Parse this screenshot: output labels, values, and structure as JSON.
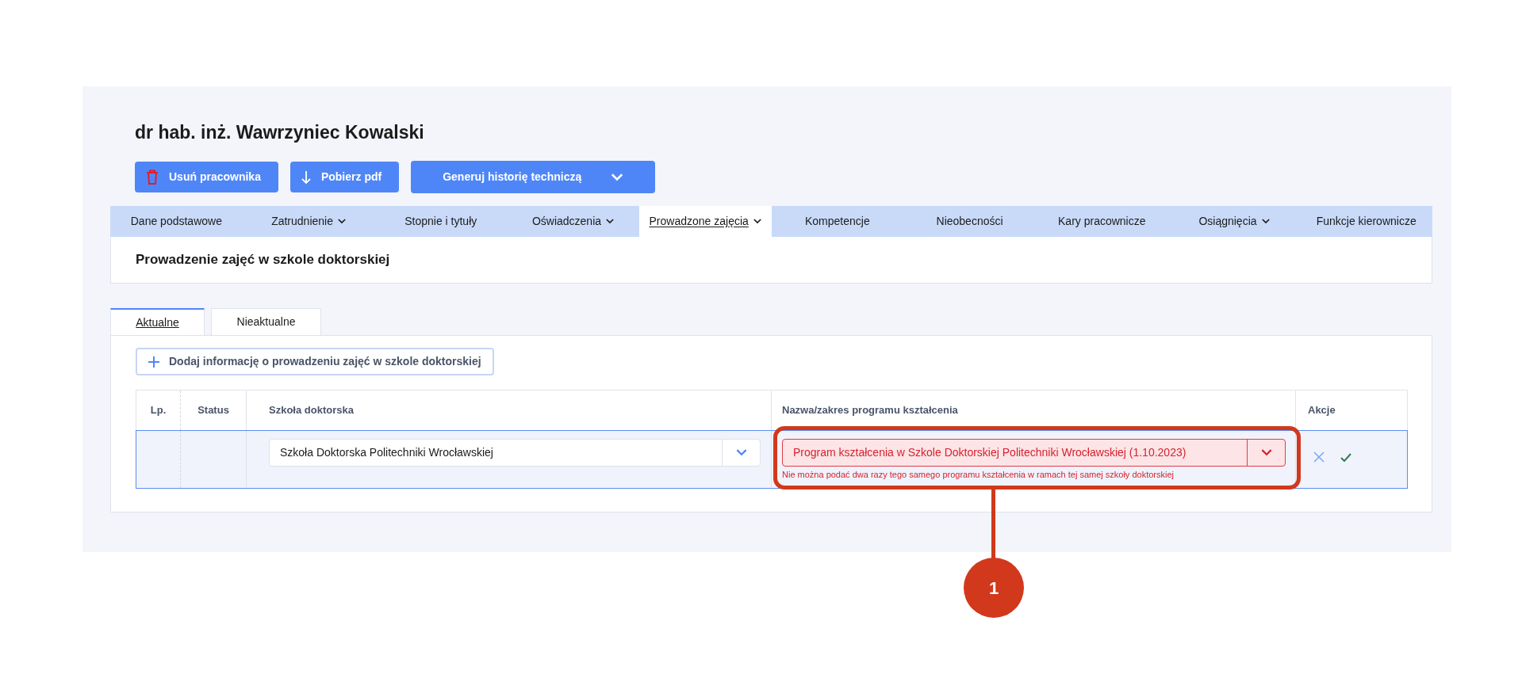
{
  "employee": {
    "name": "dr hab. inż. Wawrzyniec Kowalski"
  },
  "actions": [
    {
      "kind": "delete",
      "label": "Usuń pracownika"
    },
    {
      "kind": "download",
      "label": "Pobierz pdf"
    },
    {
      "kind": "dropdown",
      "label": "Generuj historię techniczą"
    }
  ],
  "nav_tabs": [
    {
      "label": "Dane podstawowe",
      "has_menu": false,
      "selected": false
    },
    {
      "label": "Zatrudnienie",
      "has_menu": true,
      "selected": false
    },
    {
      "label": "Stopnie i tytuły",
      "has_menu": false,
      "selected": false
    },
    {
      "label": "Oświadczenia",
      "has_menu": true,
      "selected": false
    },
    {
      "label": "Prowadzone zajęcia",
      "has_menu": true,
      "selected": true
    },
    {
      "label": "Kompetencje",
      "has_menu": false,
      "selected": false
    },
    {
      "label": "Nieobecności",
      "has_menu": false,
      "selected": false
    },
    {
      "label": "Kary pracownicze",
      "has_menu": false,
      "selected": false
    },
    {
      "label": "Osiągnięcia",
      "has_menu": true,
      "selected": false
    },
    {
      "label": "Funkcje kierownicze",
      "has_menu": false,
      "selected": false
    }
  ],
  "section_title": "Prowadzenie zajęć w szkole doktorskiej",
  "sub_tabs": [
    {
      "label": "Aktualne",
      "selected": true
    },
    {
      "label": "Nieaktualne",
      "selected": false
    }
  ],
  "add_button": "Dodaj informację o prowadzeniu zajęć w szkole doktorskiej",
  "table": {
    "columns": [
      "Lp.",
      "Status",
      "Szkoła doktorska",
      "Nazwa/zakres programu kształcenia",
      "Akcje"
    ],
    "rows": [
      {
        "school": {
          "value": "Szkoła Doktorska Politechniki Wrocławskiej",
          "invalid": false
        },
        "program": {
          "value": "Program kształcenia w Szkole Doktorskiej Politechniki Wrocławskiej (1.10.2023)",
          "invalid": true,
          "error": "Nie można podać dwa razy tego samego programu kształcenia w ramach tej samej szkoły doktorskiej"
        }
      }
    ]
  },
  "callout": {
    "number": "1"
  }
}
